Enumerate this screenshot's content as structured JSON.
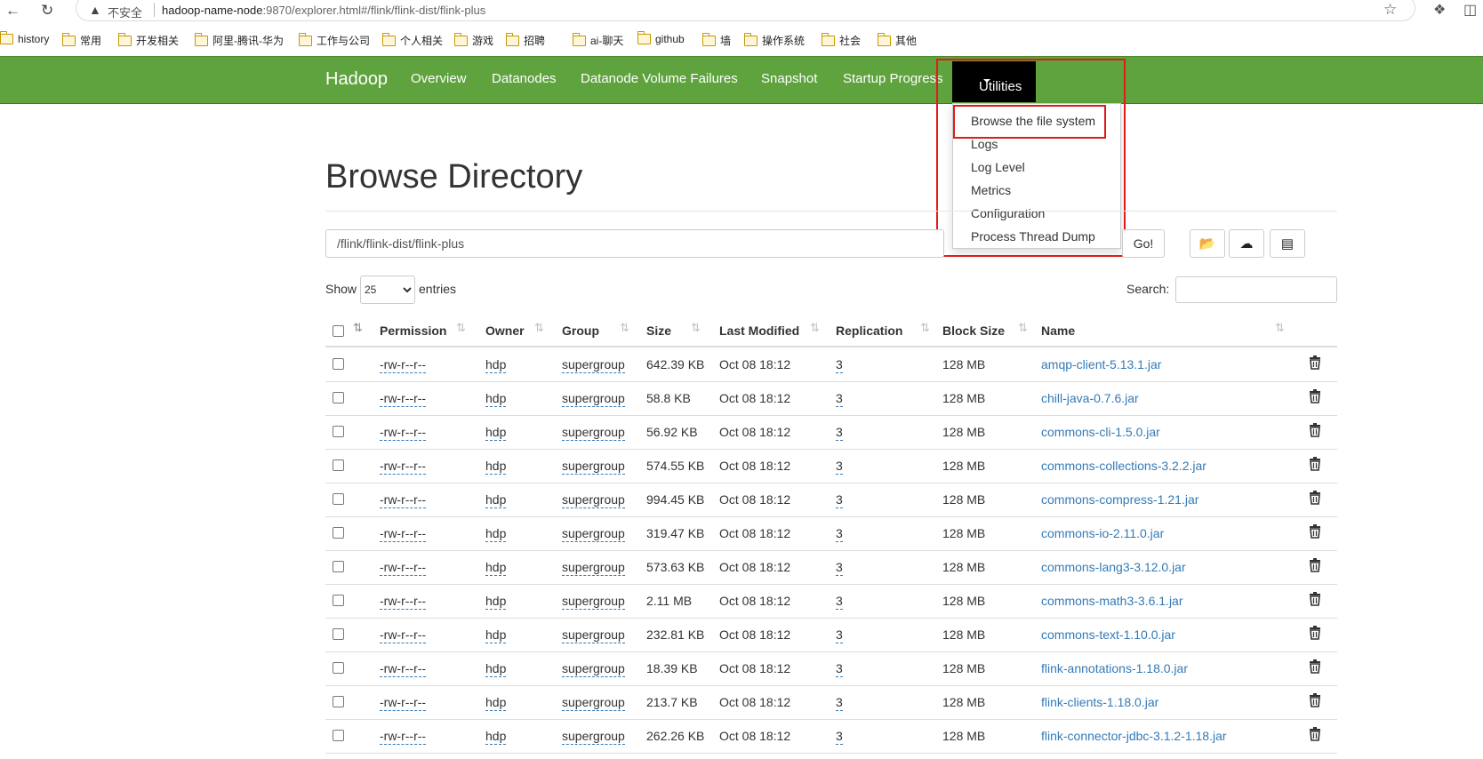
{
  "browser": {
    "insecure_label": "不安全",
    "url_host": "hadoop-name-node",
    "url_rest": ":9870/explorer.html#/flink/flink-dist/flink-plus",
    "bookmarks": [
      "history",
      "常用",
      "开发相关",
      "阿里-腾讯-华为",
      "工作与公司",
      "个人相关",
      "游戏",
      "招聘",
      "ai-聊天",
      "github",
      "墙",
      "操作系统",
      "社会",
      "其他"
    ]
  },
  "navbar": {
    "brand": "Hadoop",
    "links": [
      "Overview",
      "Datanodes",
      "Datanode Volume Failures",
      "Snapshot",
      "Startup Progress"
    ],
    "active": "Utilities",
    "dropdown": [
      "Browse the file system",
      "Logs",
      "Log Level",
      "Metrics",
      "Configuration",
      "Process Thread Dump"
    ]
  },
  "page": {
    "title": "Browse Directory",
    "path_value": "/flink/flink-dist/flink-plus",
    "go_label": "Go!",
    "show_label": "Show",
    "entries_value": "25",
    "entries_label": "entries",
    "search_label": "Search:"
  },
  "table": {
    "headers": [
      "Permission",
      "Owner",
      "Group",
      "Size",
      "Last Modified",
      "Replication",
      "Block Size",
      "Name"
    ],
    "rows": [
      {
        "permission": "-rw-r--r--",
        "owner": "hdp",
        "group": "supergroup",
        "size": "642.39 KB",
        "modified": "Oct 08 18:12",
        "replication": "3",
        "block": "128 MB",
        "name": "amqp-client-5.13.1.jar"
      },
      {
        "permission": "-rw-r--r--",
        "owner": "hdp",
        "group": "supergroup",
        "size": "58.8 KB",
        "modified": "Oct 08 18:12",
        "replication": "3",
        "block": "128 MB",
        "name": "chill-java-0.7.6.jar"
      },
      {
        "permission": "-rw-r--r--",
        "owner": "hdp",
        "group": "supergroup",
        "size": "56.92 KB",
        "modified": "Oct 08 18:12",
        "replication": "3",
        "block": "128 MB",
        "name": "commons-cli-1.5.0.jar"
      },
      {
        "permission": "-rw-r--r--",
        "owner": "hdp",
        "group": "supergroup",
        "size": "574.55 KB",
        "modified": "Oct 08 18:12",
        "replication": "3",
        "block": "128 MB",
        "name": "commons-collections-3.2.2.jar"
      },
      {
        "permission": "-rw-r--r--",
        "owner": "hdp",
        "group": "supergroup",
        "size": "994.45 KB",
        "modified": "Oct 08 18:12",
        "replication": "3",
        "block": "128 MB",
        "name": "commons-compress-1.21.jar"
      },
      {
        "permission": "-rw-r--r--",
        "owner": "hdp",
        "group": "supergroup",
        "size": "319.47 KB",
        "modified": "Oct 08 18:12",
        "replication": "3",
        "block": "128 MB",
        "name": "commons-io-2.11.0.jar"
      },
      {
        "permission": "-rw-r--r--",
        "owner": "hdp",
        "group": "supergroup",
        "size": "573.63 KB",
        "modified": "Oct 08 18:12",
        "replication": "3",
        "block": "128 MB",
        "name": "commons-lang3-3.12.0.jar"
      },
      {
        "permission": "-rw-r--r--",
        "owner": "hdp",
        "group": "supergroup",
        "size": "2.11 MB",
        "modified": "Oct 08 18:12",
        "replication": "3",
        "block": "128 MB",
        "name": "commons-math3-3.6.1.jar"
      },
      {
        "permission": "-rw-r--r--",
        "owner": "hdp",
        "group": "supergroup",
        "size": "232.81 KB",
        "modified": "Oct 08 18:12",
        "replication": "3",
        "block": "128 MB",
        "name": "commons-text-1.10.0.jar"
      },
      {
        "permission": "-rw-r--r--",
        "owner": "hdp",
        "group": "supergroup",
        "size": "18.39 KB",
        "modified": "Oct 08 18:12",
        "replication": "3",
        "block": "128 MB",
        "name": "flink-annotations-1.18.0.jar"
      },
      {
        "permission": "-rw-r--r--",
        "owner": "hdp",
        "group": "supergroup",
        "size": "213.7 KB",
        "modified": "Oct 08 18:12",
        "replication": "3",
        "block": "128 MB",
        "name": "flink-clients-1.18.0.jar"
      },
      {
        "permission": "-rw-r--r--",
        "owner": "hdp",
        "group": "supergroup",
        "size": "262.26 KB",
        "modified": "Oct 08 18:12",
        "replication": "3",
        "block": "128 MB",
        "name": "flink-connector-jdbc-3.1.2-1.18.jar"
      }
    ]
  }
}
